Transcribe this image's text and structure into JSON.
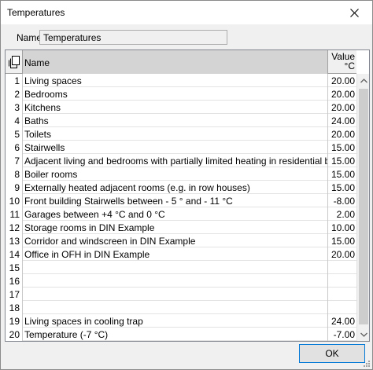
{
  "window": {
    "title": "Temperatures"
  },
  "form": {
    "name_label": "Name",
    "name_value": "Temperatures"
  },
  "grid": {
    "header": {
      "name": "Name",
      "value_line1": "Value",
      "value_line2": "°C"
    },
    "rows": [
      {
        "num": "1",
        "name": "Living spaces",
        "value": "20.00"
      },
      {
        "num": "2",
        "name": "Bedrooms",
        "value": "20.00"
      },
      {
        "num": "3",
        "name": "Kitchens",
        "value": "20.00"
      },
      {
        "num": "4",
        "name": "Baths",
        "value": "24.00"
      },
      {
        "num": "5",
        "name": "Toilets",
        "value": "20.00"
      },
      {
        "num": "6",
        "name": "Stairwells",
        "value": "15.00"
      },
      {
        "num": "7",
        "name": "Adjacent living and bedrooms with partially limited heating in residential buildings (PLH)",
        "value": "15.00"
      },
      {
        "num": "8",
        "name": "Boiler rooms",
        "value": "15.00"
      },
      {
        "num": "9",
        "name": "Externally heated adjacent rooms (e.g. in row houses)",
        "value": "15.00"
      },
      {
        "num": "10",
        "name": "Front building Stairwells between - 5 ° and - 11 °C",
        "value": "-8.00"
      },
      {
        "num": "11",
        "name": "Garages between +4 °C and 0 °C",
        "value": "2.00"
      },
      {
        "num": "12",
        "name": "Storage rooms in DIN Example",
        "value": "10.00"
      },
      {
        "num": "13",
        "name": "Corridor and windscreen in DIN Example",
        "value": "15.00"
      },
      {
        "num": "14",
        "name": "Office in OFH in DIN Example",
        "value": "20.00"
      },
      {
        "num": "15",
        "name": "",
        "value": ""
      },
      {
        "num": "16",
        "name": "",
        "value": ""
      },
      {
        "num": "17",
        "name": "",
        "value": ""
      },
      {
        "num": "18",
        "name": "",
        "value": ""
      },
      {
        "num": "19",
        "name": "Living spaces in cooling trap",
        "value": "24.00"
      },
      {
        "num": "20",
        "name": "Temperature (-7 °C)",
        "value": "-7.00"
      }
    ]
  },
  "buttons": {
    "ok_label": "OK"
  },
  "icons": {
    "close": "close-icon",
    "copy": "copy-icon",
    "scroll_up": "chevron-up-icon",
    "scroll_down": "chevron-down-icon"
  }
}
